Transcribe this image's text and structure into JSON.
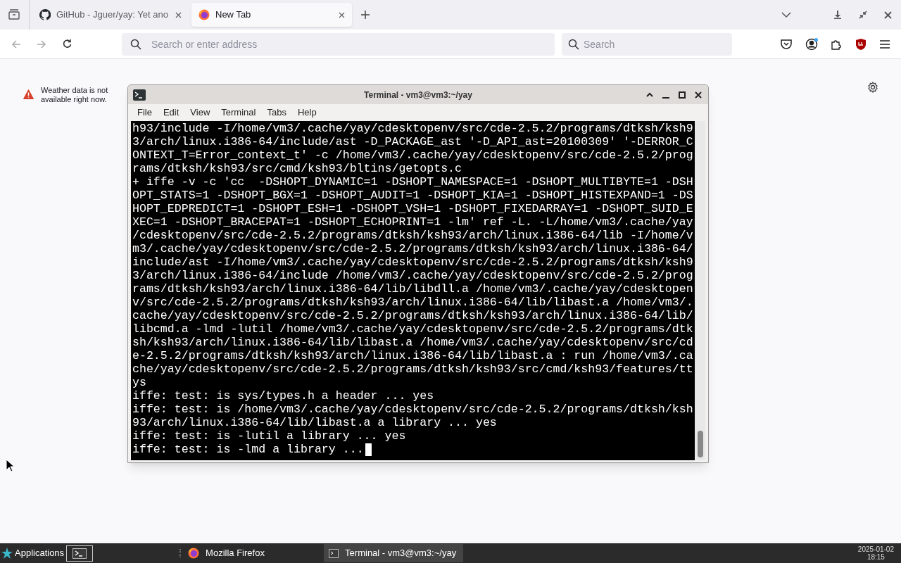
{
  "browser": {
    "tabs": [
      {
        "label": "GitHub - Jguer/yay: Yet ano",
        "selected": false,
        "kind": "github"
      },
      {
        "label": "New Tab",
        "selected": true,
        "kind": "firefox"
      }
    ],
    "address": {
      "placeholder": "Search or enter address"
    },
    "search": {
      "placeholder": "Search"
    }
  },
  "weather": {
    "message": "Weather data is not available right now."
  },
  "terminal": {
    "title": "Terminal - vm3@vm3:~/yay",
    "menu": [
      "File",
      "Edit",
      "View",
      "Terminal",
      "Tabs",
      "Help"
    ],
    "lines": [
      "h93/include -I/home/vm3/.cache/yay/cdesktopenv/src/cde-2.5.2/programs/dtksh/ksh9",
      "3/arch/linux.i386-64/include/ast -D_PACKAGE_ast '-D_API_ast=20100309' '-DERROR_C",
      "ONTEXT_T=Error_context_t' -c /home/vm3/.cache/yay/cdesktopenv/src/cde-2.5.2/prog",
      "rams/dtksh/ksh93/src/cmd/ksh93/bltins/getopts.c",
      "+ iffe -v -c 'cc  -DSHOPT_DYNAMIC=1 -DSHOPT_NAMESPACE=1 -DSHOPT_MULTIBYTE=1 -DSH",
      "OPT_STATS=1 -DSHOPT_BGX=1 -DSHOPT_AUDIT=1 -DSHOPT_KIA=1 -DSHOPT_HISTEXPAND=1 -DS",
      "HOPT_EDPREDICT=1 -DSHOPT_ESH=1 -DSHOPT_VSH=1 -DSHOPT_FIXEDARRAY=1 -DSHOPT_SUID_E",
      "XEC=1 -DSHOPT_BRACEPAT=1 -DSHOPT_ECHOPRINT=1 -lm' ref -L. -L/home/vm3/.cache/yay",
      "/cdesktopenv/src/cde-2.5.2/programs/dtksh/ksh93/arch/linux.i386-64/lib -I/home/v",
      "m3/.cache/yay/cdesktopenv/src/cde-2.5.2/programs/dtksh/ksh93/arch/linux.i386-64/",
      "include/ast -I/home/vm3/.cache/yay/cdesktopenv/src/cde-2.5.2/programs/dtksh/ksh9",
      "3/arch/linux.i386-64/include /home/vm3/.cache/yay/cdesktopenv/src/cde-2.5.2/prog",
      "rams/dtksh/ksh93/arch/linux.i386-64/lib/libdll.a /home/vm3/.cache/yay/cdesktopen",
      "v/src/cde-2.5.2/programs/dtksh/ksh93/arch/linux.i386-64/lib/libast.a /home/vm3/.",
      "cache/yay/cdesktopenv/src/cde-2.5.2/programs/dtksh/ksh93/arch/linux.i386-64/lib/",
      "libcmd.a -lmd -lutil /home/vm3/.cache/yay/cdesktopenv/src/cde-2.5.2/programs/dtk",
      "sh/ksh93/arch/linux.i386-64/lib/libast.a /home/vm3/.cache/yay/cdesktopenv/src/cd",
      "e-2.5.2/programs/dtksh/ksh93/arch/linux.i386-64/lib/libast.a : run /home/vm3/.ca",
      "che/yay/cdesktopenv/src/cde-2.5.2/programs/dtksh/ksh93/src/cmd/ksh93/features/tt",
      "ys",
      "iffe: test: is sys/types.h a header ... yes",
      "iffe: test: is /home/vm3/.cache/yay/cdesktopenv/src/cde-2.5.2/programs/dtksh/ksh",
      "93/arch/linux.i386-64/lib/libast.a a library ... yes",
      "iffe: test: is -lutil a library ... yes",
      "iffe: test: is -lmd a library ..."
    ]
  },
  "taskbar": {
    "menu": "Applications",
    "windows": [
      {
        "label": "Mozilla Firefox",
        "kind": "firefox",
        "selected": false
      },
      {
        "label": "Terminal - vm3@vm3:~/yay",
        "kind": "terminal",
        "selected": true
      }
    ],
    "date": "2025-01-02",
    "time": "18:15"
  }
}
